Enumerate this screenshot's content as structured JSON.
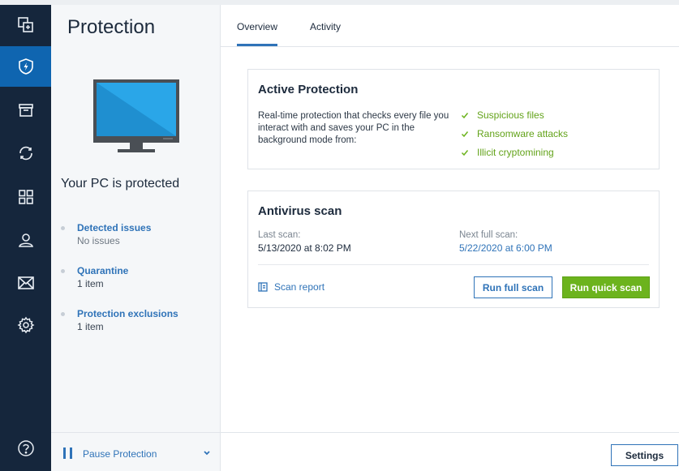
{
  "rail": {
    "items": [
      {
        "icon": "backup-icon"
      },
      {
        "icon": "shield-icon"
      },
      {
        "icon": "archive-icon"
      },
      {
        "icon": "sync-icon"
      },
      {
        "icon": "tools-icon"
      },
      {
        "icon": "account-icon"
      },
      {
        "icon": "mail-icon"
      },
      {
        "icon": "settings-icon"
      }
    ],
    "help_icon": "help-icon"
  },
  "sidebar": {
    "title": "Protection",
    "status": "Your PC is protected",
    "items": [
      {
        "label": "Detected issues",
        "value": "No issues"
      },
      {
        "label": "Quarantine",
        "value": "1 item"
      },
      {
        "label": "Protection exclusions",
        "value": "1 item"
      }
    ],
    "pause_label": "Pause Protection"
  },
  "tabs": [
    {
      "label": "Overview",
      "active": true
    },
    {
      "label": "Activity",
      "active": false
    }
  ],
  "active_protection": {
    "title": "Active Protection",
    "description": "Real-time protection that checks every file you interact with and saves your PC in the background mode from:",
    "features": [
      "Suspicious files",
      "Ransomware attacks",
      "Illicit cryptomining"
    ]
  },
  "antivirus_scan": {
    "title": "Antivirus scan",
    "last_scan_label": "Last scan:",
    "last_scan_value": "5/13/2020 at 8:02 PM",
    "next_scan_label": "Next full scan:",
    "next_scan_value": "5/22/2020 at 6:00 PM",
    "report_label": "Scan report",
    "full_scan_label": "Run full scan",
    "quick_scan_label": "Run quick scan"
  },
  "footer": {
    "settings_label": "Settings"
  },
  "colors": {
    "rail_bg": "#15263c",
    "rail_active": "#0f65b0",
    "accent_blue": "#2f73b8",
    "accent_green": "#6cb31d"
  }
}
